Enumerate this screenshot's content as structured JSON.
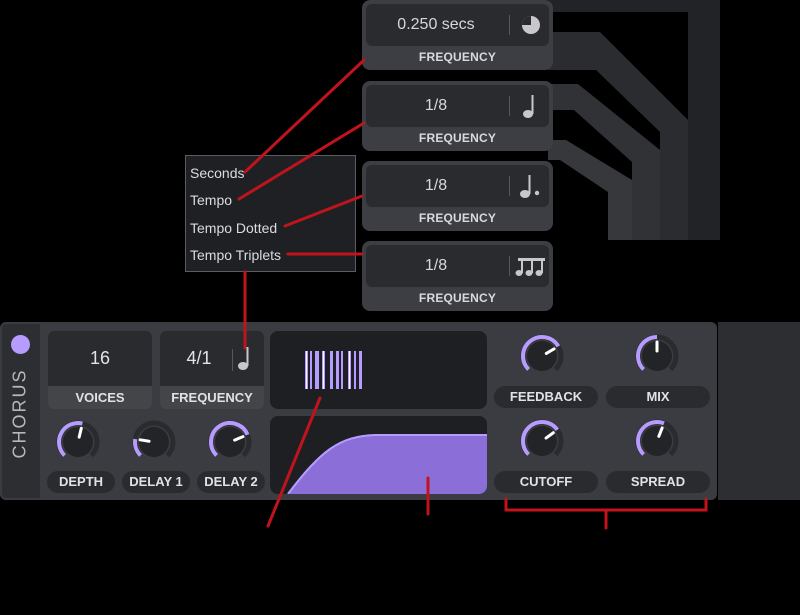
{
  "freq_boxes": [
    {
      "value": "0.250 secs",
      "label": "FREQUENCY",
      "icon": "clock-icon"
    },
    {
      "value": "1/8",
      "label": "FREQUENCY",
      "icon": "quarter-note-icon"
    },
    {
      "value": "1/8",
      "label": "FREQUENCY",
      "icon": "dotted-note-icon"
    },
    {
      "value": "1/8",
      "label": "FREQUENCY",
      "icon": "triplet-note-icon"
    }
  ],
  "menu": {
    "items": [
      "Seconds",
      "Tempo",
      "Tempo Dotted",
      "Tempo Triplets"
    ]
  },
  "chorus": {
    "title": "CHORUS",
    "voices": {
      "value": "16",
      "label": "VOICES"
    },
    "frequency": {
      "value": "4/1",
      "label": "FREQUENCY",
      "icon": "quarter-note-icon"
    },
    "knobs": {
      "depth": {
        "label": "DEPTH",
        "level": 0.55
      },
      "delay1": {
        "label": "DELAY 1",
        "level": 0.2
      },
      "delay2": {
        "label": "DELAY 2",
        "level": 0.75
      },
      "feedback": {
        "label": "FEEDBACK",
        "level": 0.72
      },
      "mix": {
        "label": "MIX",
        "level": 0.5
      },
      "cutoff": {
        "label": "CUTOFF",
        "level": 0.7
      },
      "spread": {
        "label": "SPREAD",
        "level": 0.58
      }
    }
  },
  "colors": {
    "accent": "#b79cff",
    "annotation": "#c0141c"
  }
}
